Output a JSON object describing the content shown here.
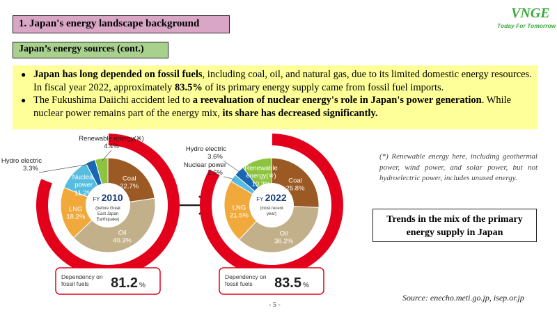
{
  "header": {
    "title": "1. Japan's energy landscape background",
    "subtitle": "Japan’s energy sources (cont.)",
    "logo_text": "VNGE",
    "logo_tagline": "Today For Tomorrow"
  },
  "bullets": [
    {
      "parts": [
        {
          "text": "Japan has long depended on fossil fuels",
          "bold": true
        },
        {
          "text": ", including coal, oil, and natural gas, due to its limited domestic energy resources. In fiscal year 2022, approximately ",
          "bold": false
        },
        {
          "text": "83.5%",
          "bold": true
        },
        {
          "text": " of its primary energy supply came from fossil fuel imports.",
          "bold": false
        }
      ]
    },
    {
      "parts": [
        {
          "text": "The Fukushima Daiichi accident led to ",
          "bold": false
        },
        {
          "text": "a reevaluation of nuclear energy's role in Japan's power generation",
          "bold": true
        },
        {
          "text": ". While nuclear power remains part of the energy mix, ",
          "bold": false
        },
        {
          "text": "its share has decreased significantly.",
          "bold": true
        }
      ]
    }
  ],
  "chart_data": [
    {
      "type": "pie",
      "title": "FY 2010",
      "year_prefix": "FY",
      "year": "2010",
      "center_note": "(before Great East Japan Earthquake)",
      "slices": [
        {
          "name": "Coal",
          "value": 22.7,
          "label_in": true,
          "color": "#9b5a23"
        },
        {
          "name": "Oil",
          "value": 40.3,
          "label_in": true,
          "color": "#c2b08a"
        },
        {
          "name": "LNG",
          "value": 18.2,
          "label_in": true,
          "color": "#f2a93b"
        },
        {
          "name": "Nuclear power",
          "value": 11.2,
          "label_in": true,
          "color": "#57bde0"
        },
        {
          "name": "Hydro electric",
          "value": 3.3,
          "label_in": false,
          "color": "#1866b4"
        },
        {
          "name": "Renewable energy(※)",
          "value": 4.4,
          "label_in": false,
          "color": "#8cc43f"
        }
      ],
      "fossil_dependency": {
        "label": "Dependency on fossil fuels",
        "value": "81.2",
        "unit": "%"
      }
    },
    {
      "type": "pie",
      "title": "FY 2022",
      "year_prefix": "FY",
      "year": "2022",
      "center_note": "(most recent year)",
      "slices": [
        {
          "name": "Coal",
          "value": 25.8,
          "label_in": true,
          "color": "#9b5a23"
        },
        {
          "name": "Oil",
          "value": 36.2,
          "label_in": true,
          "color": "#c2b08a"
        },
        {
          "name": "LNG",
          "value": 21.5,
          "label_in": true,
          "color": "#f2a93b"
        },
        {
          "name": "Nuclear power",
          "value": 2.6,
          "label_in": false,
          "color": "#57bde0"
        },
        {
          "name": "Hydro electric",
          "value": 3.6,
          "label_in": false,
          "color": "#1866b4"
        },
        {
          "name": "Renewable energy(※)",
          "value": 10.3,
          "label_in": true,
          "color": "#8cc43f"
        }
      ],
      "fossil_dependency": {
        "label": "Dependency on fossil fuels",
        "value": "83.5",
        "unit": "%"
      }
    }
  ],
  "colors": {
    "fossil_ring": "#e3001b",
    "label_box_border": "#e3001b"
  },
  "note": "(*) Renewable energy here, including geothermal power, wind power, and solar power, but not hydroelectric power, includes unused energy.",
  "trend_box": "Trends in the mix of the primary energy supply in Japan",
  "source": "Source: enecho.meti.go.jp, isep.or.jp",
  "page_number": "- 5 -"
}
